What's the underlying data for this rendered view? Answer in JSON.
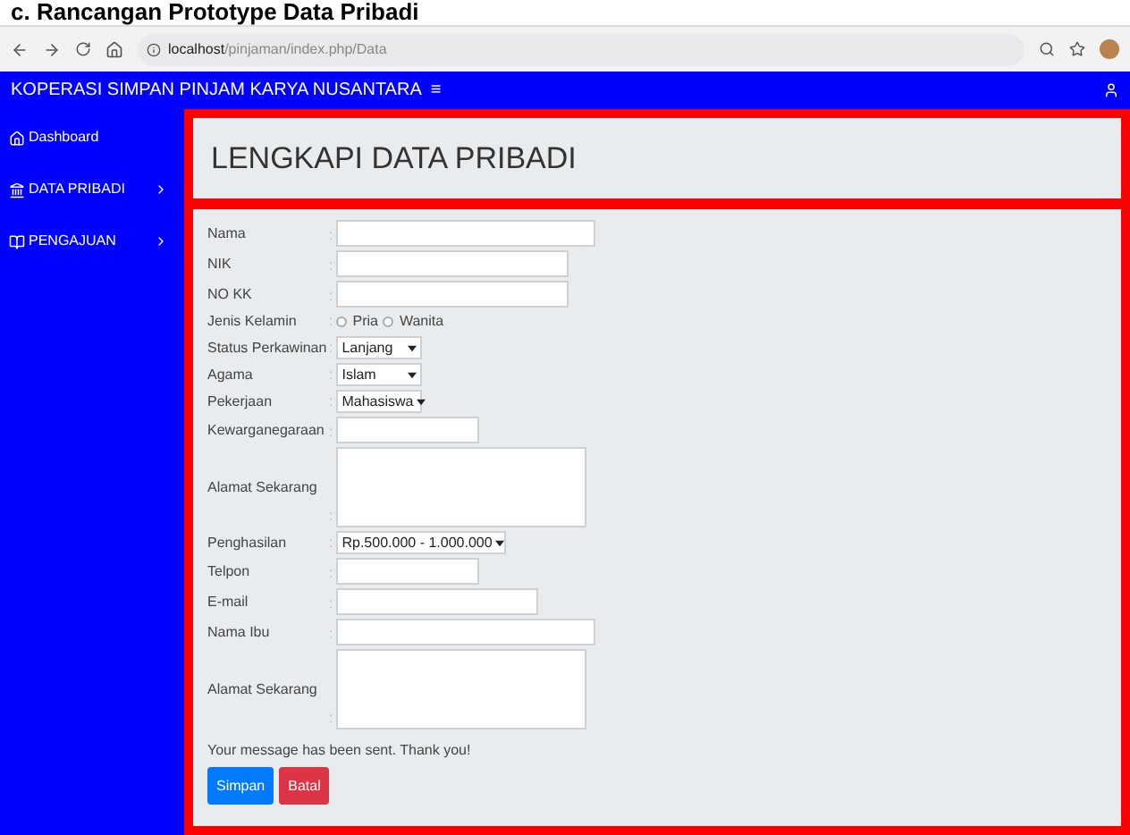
{
  "caption": "c. Rancangan Prototype Data Pribadi",
  "browser": {
    "url_host": "localhost",
    "url_path": "/pinjaman/index.php/Data"
  },
  "navbar": {
    "title": "KOPERASI SIMPAN PINJAM KARYA NUSANTARA",
    "menu_glyph": "≡"
  },
  "sidebar": {
    "items": [
      {
        "label": "Dashboard",
        "has_children": false
      },
      {
        "label": "DATA PRIBADI",
        "has_children": true
      },
      {
        "label": "PENGAJUAN",
        "has_children": true
      }
    ]
  },
  "page_title": "LENGKAPI DATA PRIBADI",
  "form": {
    "separator": ":",
    "fields": [
      {
        "label": "Nama",
        "kind": "text"
      },
      {
        "label": "NIK",
        "kind": "text"
      },
      {
        "label": "NO KK",
        "kind": "text"
      },
      {
        "label": "Jenis Kelamin",
        "kind": "radio",
        "options": [
          {
            "label": "Pria",
            "selected": false
          },
          {
            "label": "Wanita",
            "selected": false
          }
        ]
      },
      {
        "label": "Status Perkawinan",
        "kind": "select",
        "value": "Lanjang"
      },
      {
        "label": "Agama",
        "kind": "select",
        "value": "Islam"
      },
      {
        "label": "Pekerjaan",
        "kind": "select",
        "value": "Mahasiswa"
      },
      {
        "label": "Kewarganegaraan",
        "kind": "text"
      },
      {
        "label": "Alamat Sekarang",
        "kind": "textarea"
      },
      {
        "label": "Penghasilan",
        "kind": "select",
        "value": "Rp.500.000 - 1.000.000"
      },
      {
        "label": "Telpon",
        "kind": "text"
      },
      {
        "label": "E-mail",
        "kind": "text"
      },
      {
        "label": "Nama Ibu",
        "kind": "text"
      },
      {
        "label": "Alamat Sekarang",
        "kind": "textarea"
      }
    ],
    "message": "Your message has been sent. Thank you!",
    "buttons": [
      {
        "label": "Simpan",
        "kind": "primary"
      },
      {
        "label": "Batal",
        "kind": "danger"
      }
    ]
  }
}
